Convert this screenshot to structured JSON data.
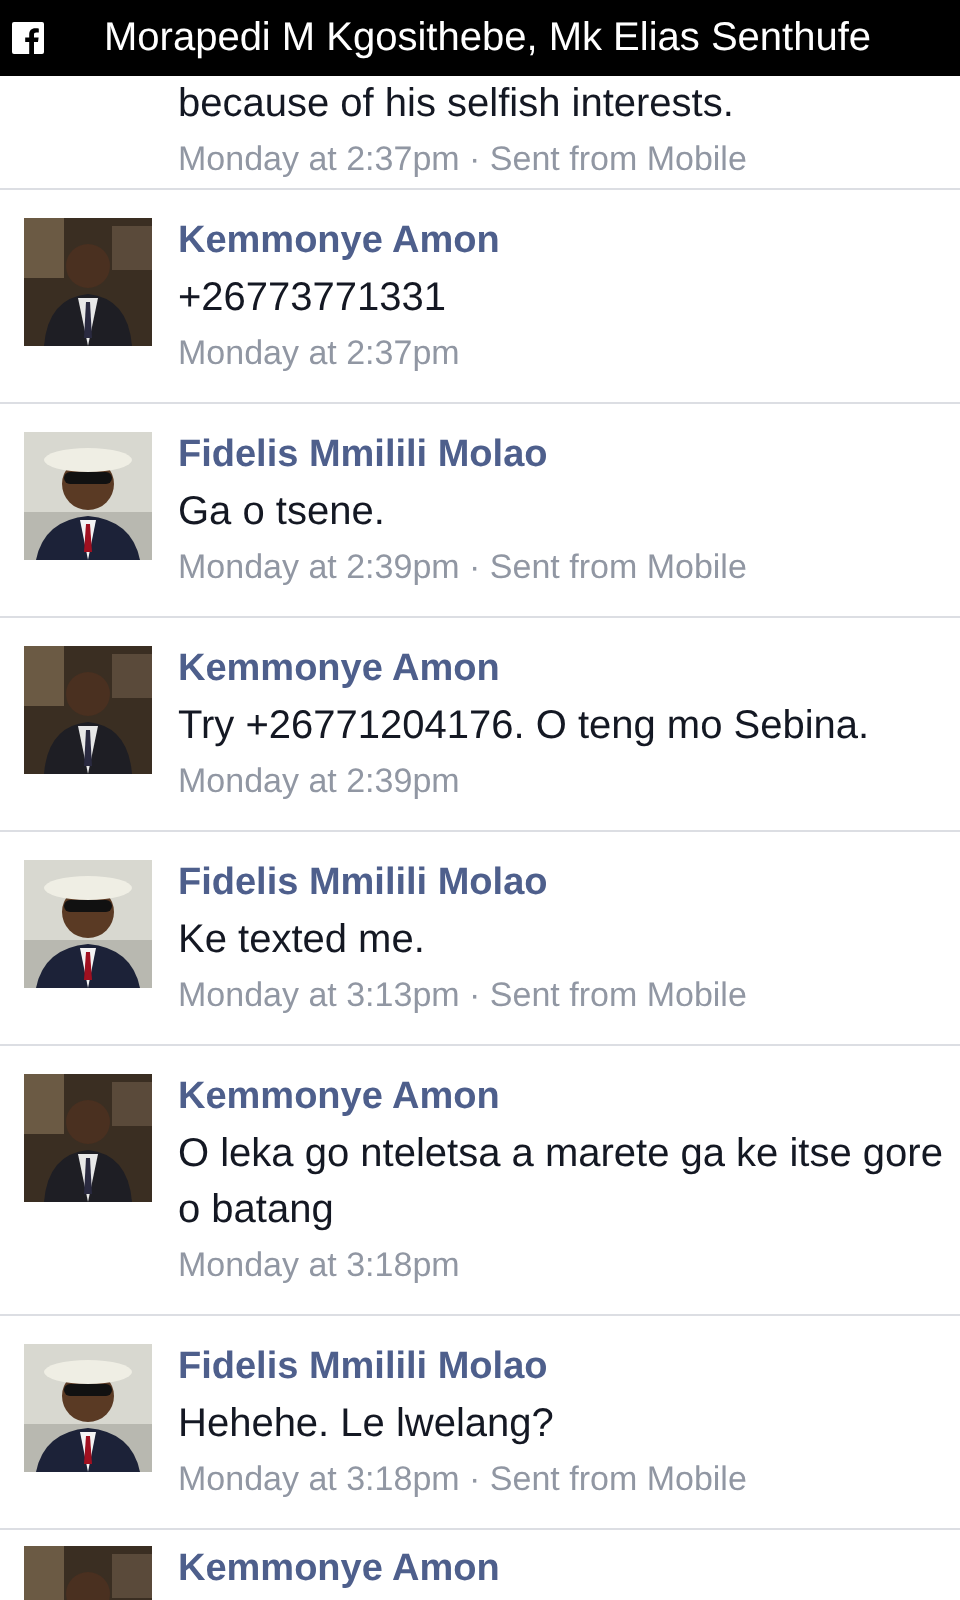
{
  "header": {
    "title": "Morapedi M Kgosithebe, Mk Elias Senthufe"
  },
  "messages": [
    {
      "text": "because of his selfish interests.",
      "meta": "Monday at 2:37pm · Sent from Mobile"
    },
    {
      "sender": "Kemmonye Amon",
      "text": "+26773771331",
      "meta": "Monday at 2:37pm"
    },
    {
      "sender": "Fidelis Mmilili Molao",
      "text": "Ga o tsene.",
      "meta": "Monday at 2:39pm · Sent from Mobile"
    },
    {
      "sender": "Kemmonye Amon",
      "text": "Try +26771204176. O teng mo Sebina.",
      "meta": "Monday at 2:39pm"
    },
    {
      "sender": "Fidelis Mmilili Molao",
      "text": "Ke texted me.",
      "meta": "Monday at 3:13pm · Sent from Mobile"
    },
    {
      "sender": "Kemmonye Amon",
      "text": "O leka go nteletsa a marete ga ke itse gore o batang",
      "meta": "Monday at 3:18pm"
    },
    {
      "sender": "Fidelis Mmilili Molao",
      "text": "Hehehe. Le lwelang?",
      "meta": "Monday at 3:18pm · Sent from Mobile"
    },
    {
      "sender": "Kemmonye Amon"
    }
  ]
}
